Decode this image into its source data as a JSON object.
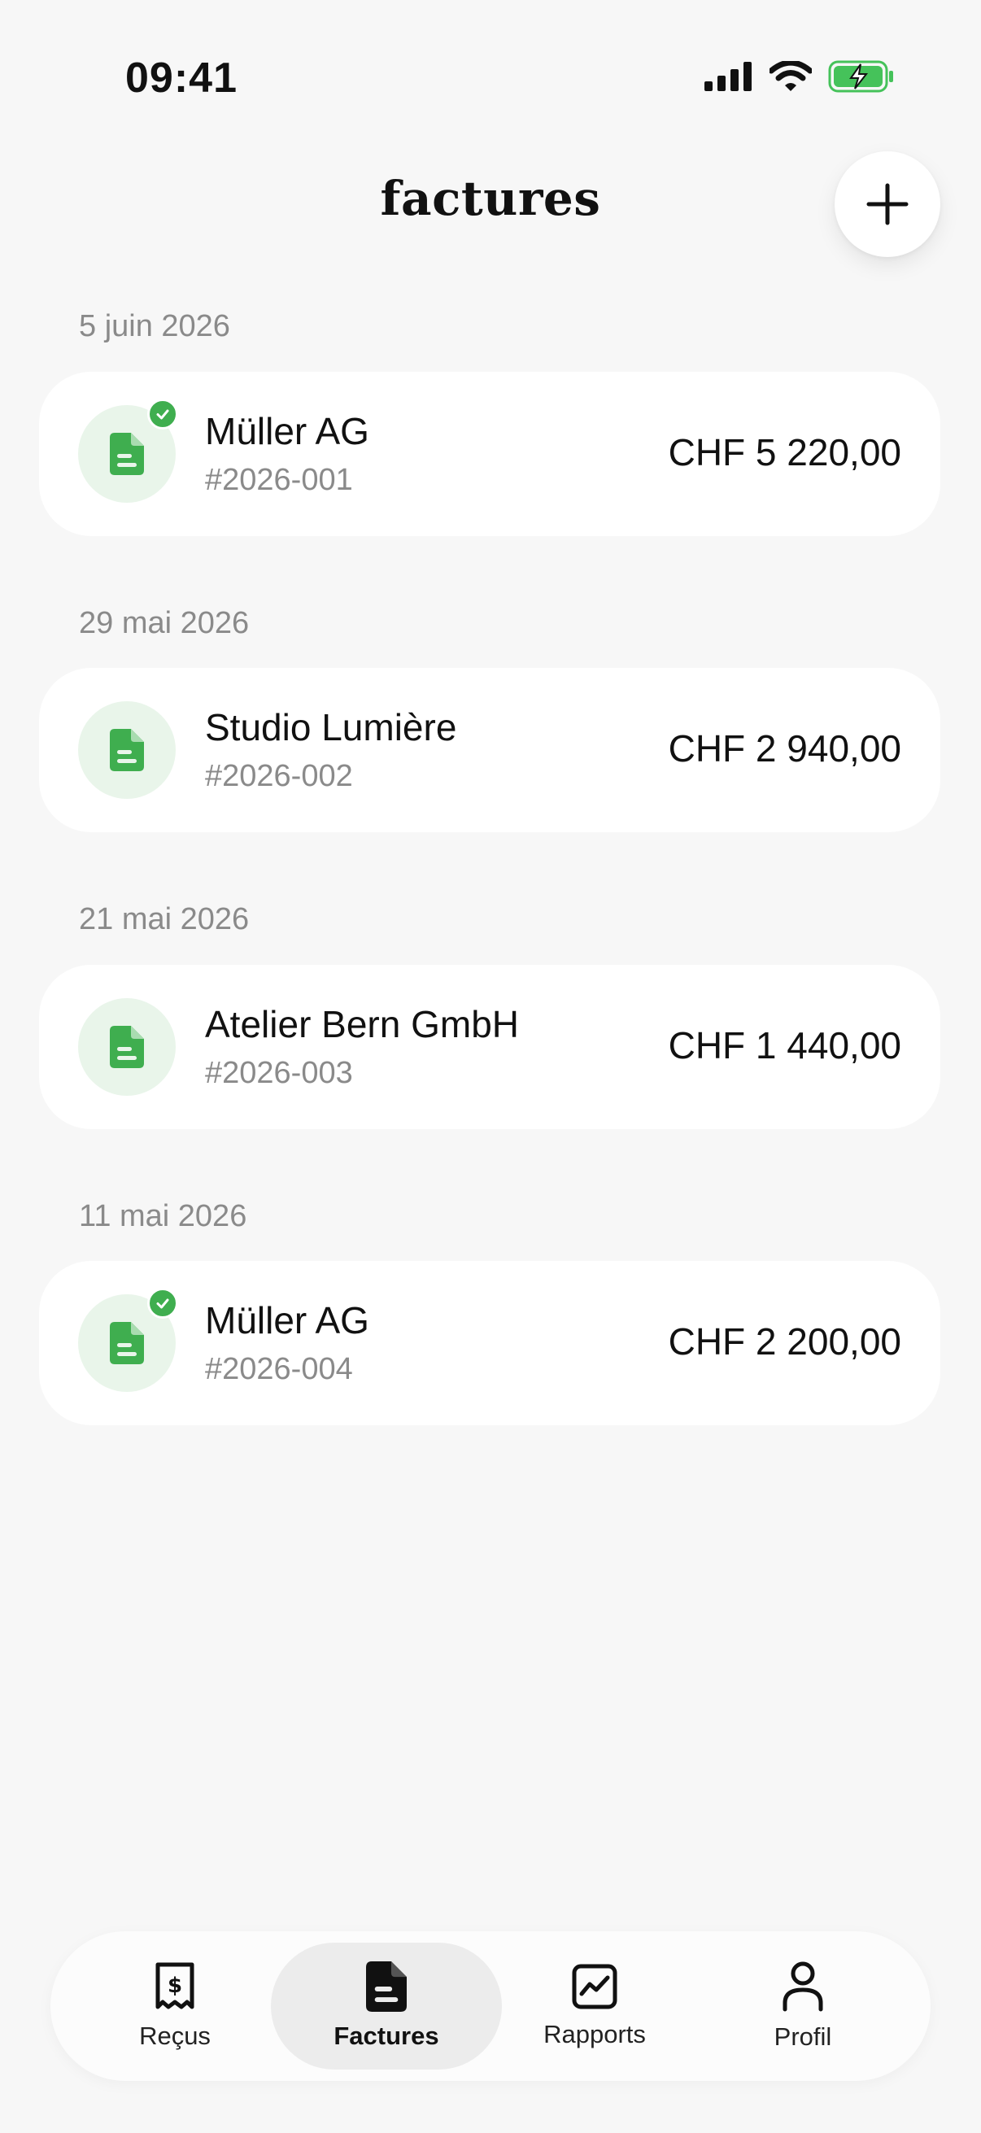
{
  "status_bar": {
    "time": "09:41"
  },
  "header": {
    "title": "factures"
  },
  "invoices": [
    {
      "date": "5 juin 2026",
      "client": "Müller AG",
      "number": "#2026-001",
      "amount": "CHF 5 220,00",
      "paid": true
    },
    {
      "date": "29 mai 2026",
      "client": "Studio Lumière",
      "number": "#2026-002",
      "amount": "CHF 2 940,00",
      "paid": false
    },
    {
      "date": "21 mai 2026",
      "client": "Atelier Bern GmbH",
      "number": "#2026-003",
      "amount": "CHF 1 440,00",
      "paid": false
    },
    {
      "date": "11 mai 2026",
      "client": "Müller AG",
      "number": "#2026-004",
      "amount": "CHF 2 200,00",
      "paid": true
    }
  ],
  "tab_bar": {
    "tabs": [
      {
        "label": "Reçus",
        "icon": "receipt-icon",
        "active": false
      },
      {
        "label": "Factures",
        "icon": "document-icon",
        "active": true
      },
      {
        "label": "Rapports",
        "icon": "chart-icon",
        "active": false
      },
      {
        "label": "Profil",
        "icon": "person-icon",
        "active": false
      }
    ]
  },
  "colors": {
    "accent_green": "#3fae4f",
    "badge_bg": "#e9f5ea",
    "page_bg": "#f7f7f7"
  }
}
